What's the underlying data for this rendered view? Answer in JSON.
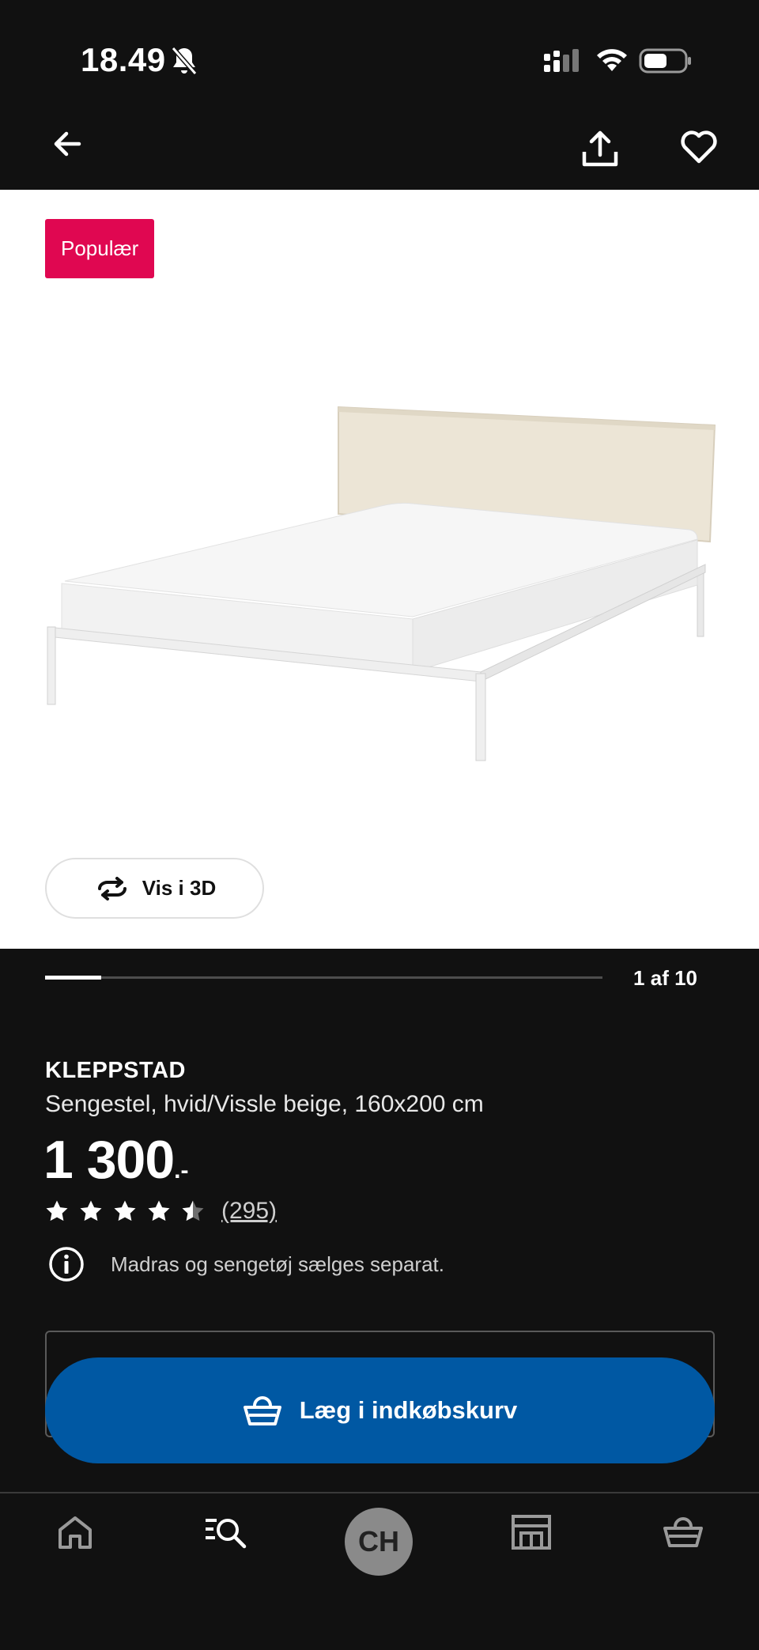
{
  "status_bar": {
    "time": "18.49",
    "icons": [
      "bell-off-icon",
      "signal-icon",
      "wifi-icon",
      "battery-icon"
    ]
  },
  "app_bar": {
    "icons": [
      "back-arrow-icon",
      "share-icon",
      "heart-icon"
    ]
  },
  "gallery": {
    "badge": "Populær",
    "view_3d_label": "Vis i 3D",
    "counter": "1 af 10",
    "progress_fraction": 0.1
  },
  "product": {
    "name": "KLEPPSTAD",
    "description": "Sengestel, hvid/Vissle beige, 160x200 cm",
    "price": "1 300",
    "price_suffix": ".-",
    "rating": 4.5,
    "rating_max": 5,
    "review_count": "(295)",
    "info_note": "Madras og sengetøj sælges separat."
  },
  "actions": {
    "add_to_cart": "Læg i indkøbskurv"
  },
  "bottom_nav": {
    "profile_initials": "CH",
    "items": [
      "home-icon",
      "search-icon",
      "profile-avatar",
      "store-icon",
      "cart-icon"
    ]
  },
  "colors": {
    "background": "#111111",
    "badge": "#e00751",
    "primary_button": "#0058a3"
  }
}
